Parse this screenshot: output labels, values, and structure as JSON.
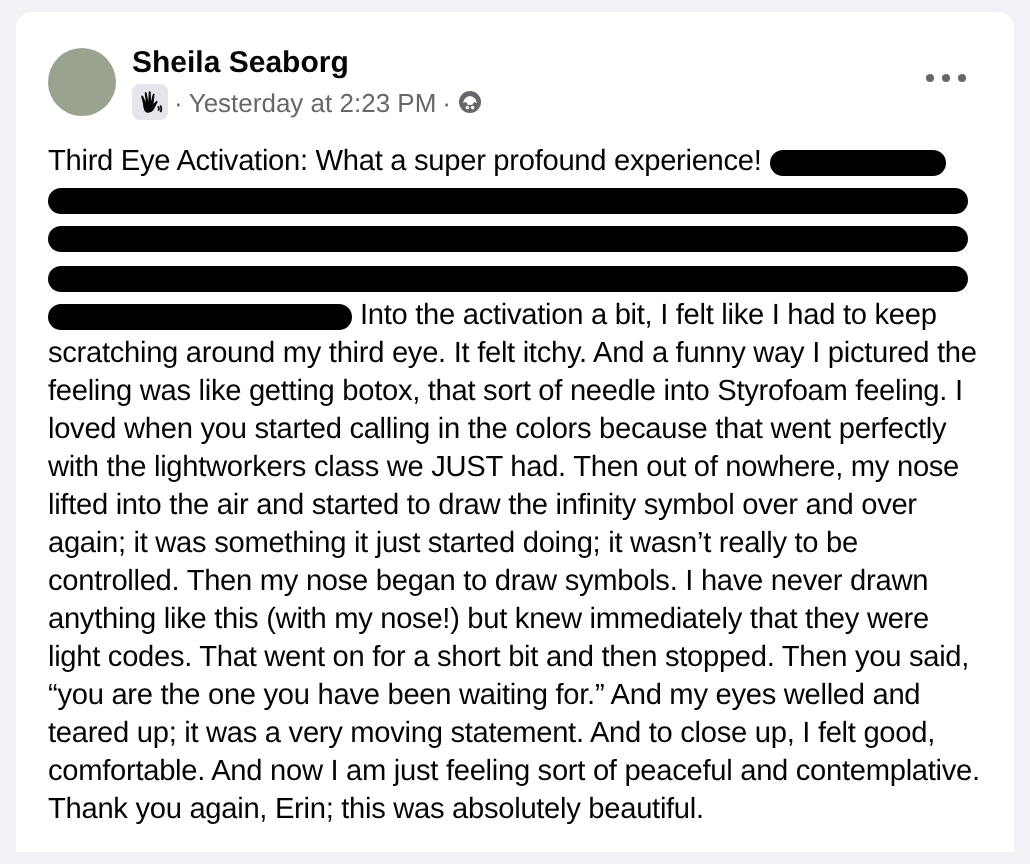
{
  "post": {
    "author": "Sheila Seaborg",
    "separators": [
      "·",
      "·"
    ],
    "time": "Yesterday at 2:23 PM",
    "text_before_redaction": "Third Eye Activation: What a super profound experience!",
    "text_after_redaction": "Into the activation a bit, I felt like I had to keep",
    "text_continued": "scratching around my third eye. It felt itchy. And a funny way I pictured the feeling was like getting botox, that sort of needle into Styrofoam feeling. I loved when you started calling in the colors because that went perfectly with the lightworkers class we JUST had. Then out of nowhere, my nose lifted into the air and started to draw the infinity symbol over and over again; it was something it just started doing; it wasn’t really to be controlled. Then my nose began to draw symbols. I have never drawn anything like this (with my nose!) but knew immediately that they were light codes. That went on for a short bit and then stopped. Then you said, “you are the one you have been waiting for.” And my eyes welled and teared up; it was a very moving statement. And to close up, I felt good, comfortable. And now I am just feeling sort of peaceful and contemplative. Thank you again, Erin; this was absolutely beautiful."
  }
}
